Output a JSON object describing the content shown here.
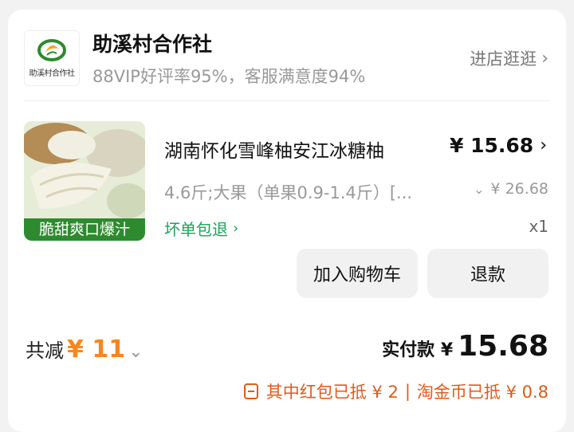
{
  "store": {
    "logo_text": "助溪村合作社",
    "name": "助溪村合作社",
    "stats": "88VIP好评率95%，客服满意度94%",
    "visit_label": "进店逛逛"
  },
  "product": {
    "thumb_caption": "脆甜爽口爆汁",
    "title": "湖南怀化雪峰柚安江冰糖柚",
    "price": "¥ 15.68",
    "sku": "4.6斤;大果（单果0.9-1.4斤）[...",
    "original_price": "¥ 26.68",
    "guarantee": "坏单包退",
    "quantity": "x1"
  },
  "actions": {
    "add_to_cart": "加入购物车",
    "refund": "退款"
  },
  "totals": {
    "discount_label": "共减",
    "discount_amount": "¥ 11",
    "paid_label": "实付款 ¥",
    "paid_amount": "15.68",
    "red_packet": "其中红包已抵 ¥ 2",
    "coins": "淘金币已抵 ¥ 0.8"
  },
  "colors": {
    "accent_orange": "#f5871f",
    "subsidy_orange": "#e05a1a",
    "guarantee_green": "#1aa35a"
  },
  "icons": [
    "chevron-right-icon",
    "chevron-down-icon",
    "coupon-icon"
  ]
}
